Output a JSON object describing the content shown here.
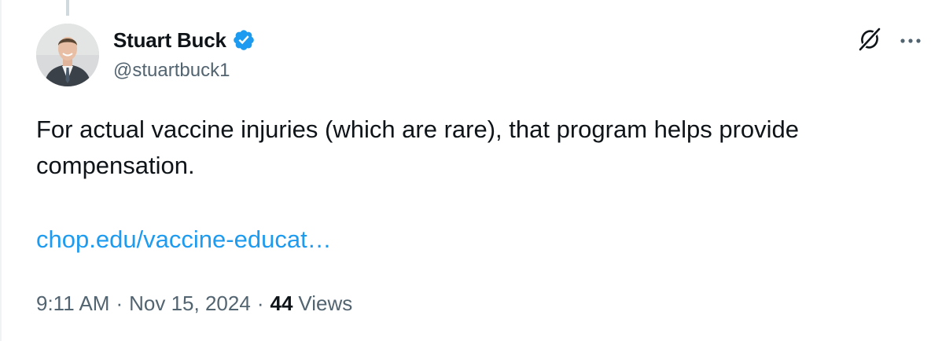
{
  "tweet": {
    "author": {
      "display_name": "Stuart Buck",
      "handle": "@stuartbuck1",
      "verified": true
    },
    "text": "For actual vaccine injuries (which are rare), that program helps provide\ncompensation.",
    "link_text": "chop.edu/vaccine-educat…",
    "time": "9:11 AM",
    "separator": "·",
    "date": "Nov 15, 2024",
    "views_count": "44",
    "views_label": "Views"
  },
  "icons": {
    "verified": "verified-badge-icon",
    "grok": "grok-icon",
    "more": "more-options-icon"
  },
  "colors": {
    "text_primary": "#0f1419",
    "text_secondary": "#536471",
    "link": "#1d9bf0",
    "verified_badge": "#1d9bf0",
    "thread_line": "#cfd9de"
  }
}
